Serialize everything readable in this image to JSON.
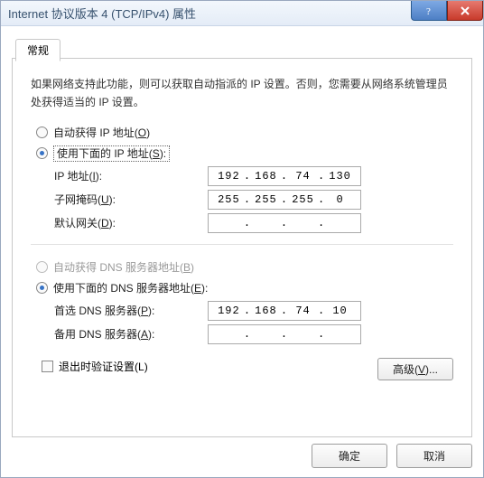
{
  "window": {
    "title": "Internet 协议版本 4 (TCP/IPv4) 属性"
  },
  "tab": {
    "label": "常规"
  },
  "description": "如果网络支持此功能，则可以获取自动指派的 IP 设置。否则，您需要从网络系统管理员处获得适当的 IP 设置。",
  "ip_section": {
    "auto_label_pre": "自动获得 IP 地址(",
    "auto_key": "O",
    "auto_label_post": ")",
    "manual_label_pre": "使用下面的 IP 地址(",
    "manual_key": "S",
    "manual_label_post": "):",
    "fields": {
      "ip_label_pre": "IP 地址(",
      "ip_key": "I",
      "ip_label_post": "):",
      "ip_value": [
        "192",
        "168",
        "74",
        "130"
      ],
      "mask_label_pre": "子网掩码(",
      "mask_key": "U",
      "mask_label_post": "):",
      "mask_value": [
        "255",
        "255",
        "255",
        "0"
      ],
      "gw_label_pre": "默认网关(",
      "gw_key": "D",
      "gw_label_post": "):",
      "gw_value": [
        "",
        "",
        "",
        ""
      ]
    }
  },
  "dns_section": {
    "auto_label_pre": "自动获得 DNS 服务器地址(",
    "auto_key": "B",
    "auto_label_post": ")",
    "manual_label_pre": "使用下面的 DNS 服务器地址(",
    "manual_key": "E",
    "manual_label_post": "):",
    "fields": {
      "pref_label_pre": "首选 DNS 服务器(",
      "pref_key": "P",
      "pref_label_post": "):",
      "pref_value": [
        "192",
        "168",
        "74",
        "10"
      ],
      "alt_label_pre": "备用 DNS 服务器(",
      "alt_key": "A",
      "alt_label_post": "):",
      "alt_value": [
        "",
        "",
        "",
        ""
      ]
    }
  },
  "validate": {
    "label_pre": "退出时验证设置(",
    "key": "L",
    "label_post": ")"
  },
  "advanced": {
    "label_pre": "高级(",
    "key": "V",
    "label_post": ")..."
  },
  "buttons": {
    "ok": "确定",
    "cancel": "取消"
  },
  "dot": "."
}
